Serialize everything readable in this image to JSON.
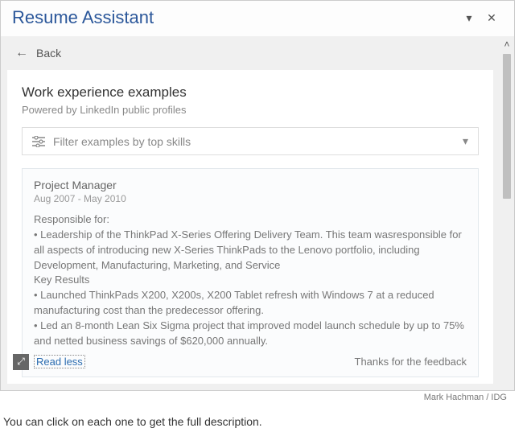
{
  "titlebar": {
    "title": "Resume Assistant"
  },
  "back": {
    "label": "Back"
  },
  "section": {
    "title": "Work experience examples",
    "subtitle": "Powered by LinkedIn public profiles"
  },
  "filter": {
    "label": "Filter examples by top skills"
  },
  "example": {
    "job_title": "Project Manager",
    "dates": "Aug 2007 - May 2010",
    "body": "Responsible for:\n• Leadership of the ThinkPad X-Series Offering Delivery Team. This team wasresponsible for all aspects of introducing new X-Series ThinkPads to the Lenovo portfolio, including Development, Manufacturing, Marketing, and Service\nKey Results\n• Launched ThinkPads X200, X200s, X200 Tablet refresh with Windows 7 at a reduced manufacturing cost than the predecessor offering.\n• Led an 8-month Lean Six Sigma project that improved model launch schedule by up to 75% and netted business savings of $620,000 annually.",
    "read_less": "Read less",
    "feedback": "Thanks for the feedback"
  },
  "credit": "Mark Hachman / IDG",
  "caption": "You can click on each one to get the full description."
}
